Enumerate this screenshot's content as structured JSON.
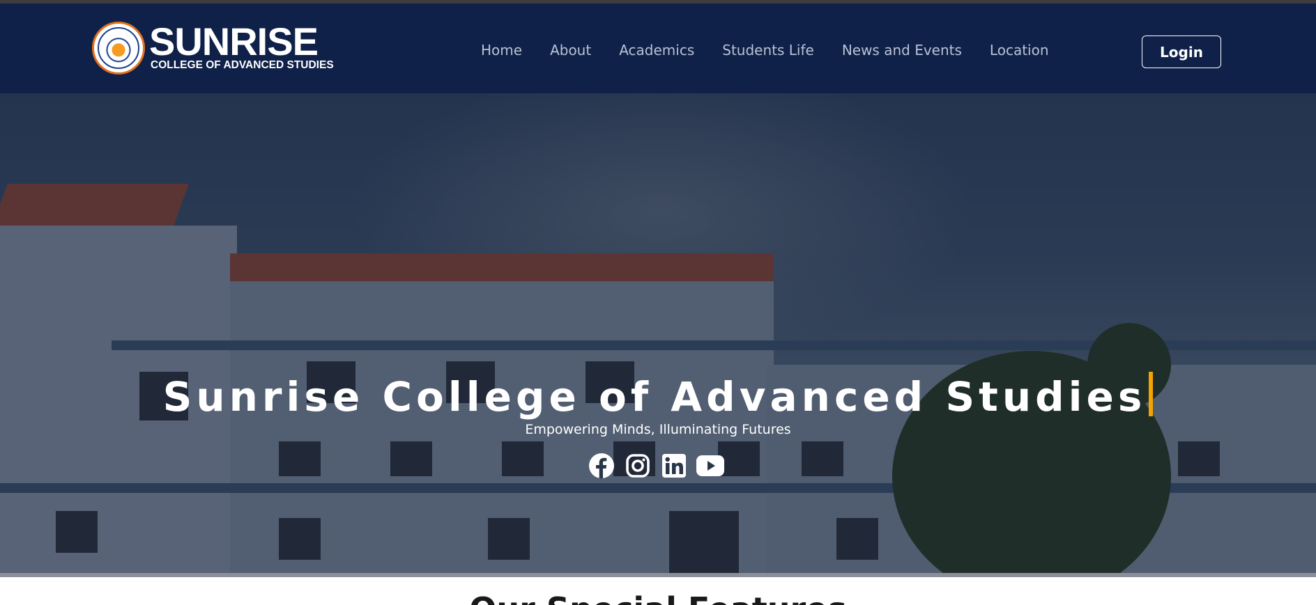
{
  "brand": {
    "name": "SUNRISE",
    "tagline": "COLLEGE OF ADVANCED STUDIES",
    "seal_text": "SUNRISE COLLEGE OF ADVANCED STUDIES"
  },
  "nav": {
    "items": [
      {
        "label": "Home"
      },
      {
        "label": "About"
      },
      {
        "label": "Academics"
      },
      {
        "label": "Students Life"
      },
      {
        "label": "News and Events"
      },
      {
        "label": "Location"
      }
    ],
    "login_label": "Login"
  },
  "hero": {
    "title": "Sunrise College of Advanced Studies",
    "subtitle": "Empowering Minds, Illuminating Futures",
    "socials": [
      "facebook-icon",
      "instagram-icon",
      "linkedin-icon",
      "youtube-icon"
    ]
  },
  "section": {
    "title": "Our Special Features"
  },
  "colors": {
    "navbar": "#0f2149",
    "accent_caret": "#f4a300",
    "nav_text": "#b9c2d4",
    "seal_border": "#e0701e"
  }
}
